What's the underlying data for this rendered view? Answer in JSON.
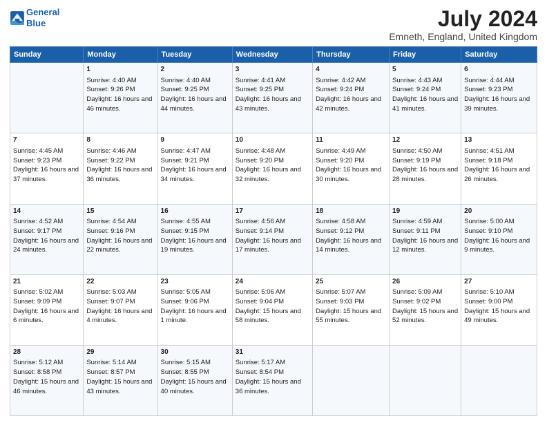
{
  "header": {
    "logo_line1": "General",
    "logo_line2": "Blue",
    "title": "July 2024",
    "subtitle": "Emneth, England, United Kingdom"
  },
  "days_of_week": [
    "Sunday",
    "Monday",
    "Tuesday",
    "Wednesday",
    "Thursday",
    "Friday",
    "Saturday"
  ],
  "weeks": [
    [
      {
        "day": "",
        "info": ""
      },
      {
        "day": "1",
        "info": "Sunrise: 4:40 AM\nSunset: 9:26 PM\nDaylight: 16 hours and 46 minutes."
      },
      {
        "day": "2",
        "info": "Sunrise: 4:40 AM\nSunset: 9:25 PM\nDaylight: 16 hours and 44 minutes."
      },
      {
        "day": "3",
        "info": "Sunrise: 4:41 AM\nSunset: 9:25 PM\nDaylight: 16 hours and 43 minutes."
      },
      {
        "day": "4",
        "info": "Sunrise: 4:42 AM\nSunset: 9:24 PM\nDaylight: 16 hours and 42 minutes."
      },
      {
        "day": "5",
        "info": "Sunrise: 4:43 AM\nSunset: 9:24 PM\nDaylight: 16 hours and 41 minutes."
      },
      {
        "day": "6",
        "info": "Sunrise: 4:44 AM\nSunset: 9:23 PM\nDaylight: 16 hours and 39 minutes."
      }
    ],
    [
      {
        "day": "7",
        "info": "Sunrise: 4:45 AM\nSunset: 9:23 PM\nDaylight: 16 hours and 37 minutes."
      },
      {
        "day": "8",
        "info": "Sunrise: 4:46 AM\nSunset: 9:22 PM\nDaylight: 16 hours and 36 minutes."
      },
      {
        "day": "9",
        "info": "Sunrise: 4:47 AM\nSunset: 9:21 PM\nDaylight: 16 hours and 34 minutes."
      },
      {
        "day": "10",
        "info": "Sunrise: 4:48 AM\nSunset: 9:20 PM\nDaylight: 16 hours and 32 minutes."
      },
      {
        "day": "11",
        "info": "Sunrise: 4:49 AM\nSunset: 9:20 PM\nDaylight: 16 hours and 30 minutes."
      },
      {
        "day": "12",
        "info": "Sunrise: 4:50 AM\nSunset: 9:19 PM\nDaylight: 16 hours and 28 minutes."
      },
      {
        "day": "13",
        "info": "Sunrise: 4:51 AM\nSunset: 9:18 PM\nDaylight: 16 hours and 26 minutes."
      }
    ],
    [
      {
        "day": "14",
        "info": "Sunrise: 4:52 AM\nSunset: 9:17 PM\nDaylight: 16 hours and 24 minutes."
      },
      {
        "day": "15",
        "info": "Sunrise: 4:54 AM\nSunset: 9:16 PM\nDaylight: 16 hours and 22 minutes."
      },
      {
        "day": "16",
        "info": "Sunrise: 4:55 AM\nSunset: 9:15 PM\nDaylight: 16 hours and 19 minutes."
      },
      {
        "day": "17",
        "info": "Sunrise: 4:56 AM\nSunset: 9:14 PM\nDaylight: 16 hours and 17 minutes."
      },
      {
        "day": "18",
        "info": "Sunrise: 4:58 AM\nSunset: 9:12 PM\nDaylight: 16 hours and 14 minutes."
      },
      {
        "day": "19",
        "info": "Sunrise: 4:59 AM\nSunset: 9:11 PM\nDaylight: 16 hours and 12 minutes."
      },
      {
        "day": "20",
        "info": "Sunrise: 5:00 AM\nSunset: 9:10 PM\nDaylight: 16 hours and 9 minutes."
      }
    ],
    [
      {
        "day": "21",
        "info": "Sunrise: 5:02 AM\nSunset: 9:09 PM\nDaylight: 16 hours and 6 minutes."
      },
      {
        "day": "22",
        "info": "Sunrise: 5:03 AM\nSunset: 9:07 PM\nDaylight: 16 hours and 4 minutes."
      },
      {
        "day": "23",
        "info": "Sunrise: 5:05 AM\nSunset: 9:06 PM\nDaylight: 16 hours and 1 minute."
      },
      {
        "day": "24",
        "info": "Sunrise: 5:06 AM\nSunset: 9:04 PM\nDaylight: 15 hours and 58 minutes."
      },
      {
        "day": "25",
        "info": "Sunrise: 5:07 AM\nSunset: 9:03 PM\nDaylight: 15 hours and 55 minutes."
      },
      {
        "day": "26",
        "info": "Sunrise: 5:09 AM\nSunset: 9:02 PM\nDaylight: 15 hours and 52 minutes."
      },
      {
        "day": "27",
        "info": "Sunrise: 5:10 AM\nSunset: 9:00 PM\nDaylight: 15 hours and 49 minutes."
      }
    ],
    [
      {
        "day": "28",
        "info": "Sunrise: 5:12 AM\nSunset: 8:58 PM\nDaylight: 15 hours and 46 minutes."
      },
      {
        "day": "29",
        "info": "Sunrise: 5:14 AM\nSunset: 8:57 PM\nDaylight: 15 hours and 43 minutes."
      },
      {
        "day": "30",
        "info": "Sunrise: 5:15 AM\nSunset: 8:55 PM\nDaylight: 15 hours and 40 minutes."
      },
      {
        "day": "31",
        "info": "Sunrise: 5:17 AM\nSunset: 8:54 PM\nDaylight: 15 hours and 36 minutes."
      },
      {
        "day": "",
        "info": ""
      },
      {
        "day": "",
        "info": ""
      },
      {
        "day": "",
        "info": ""
      }
    ]
  ]
}
